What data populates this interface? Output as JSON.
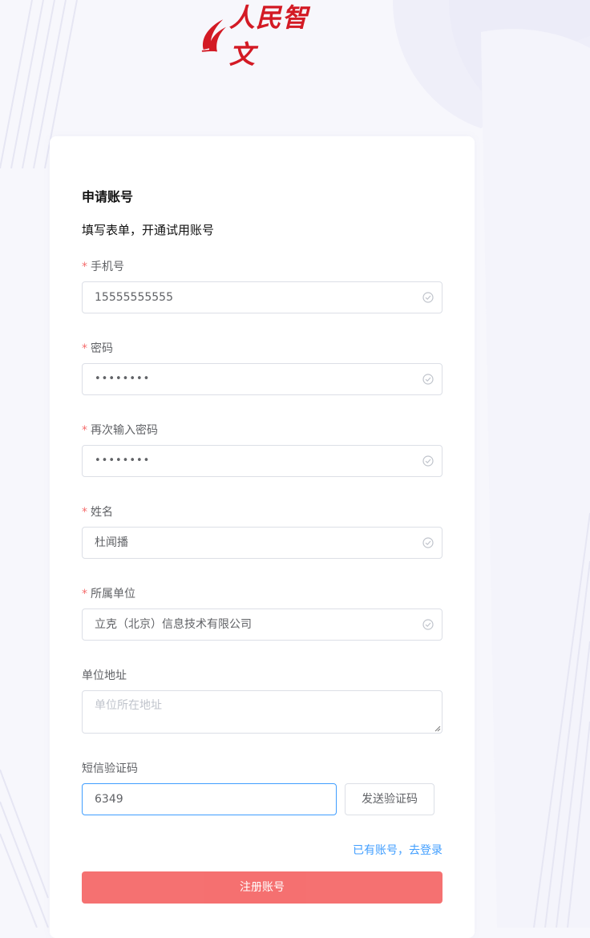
{
  "brand": {
    "logo_text": "人民智文",
    "accent": "#d31a24"
  },
  "form": {
    "title": "申请账号",
    "subtitle": "填写表单，开通试用账号",
    "fields": [
      {
        "label": "手机号",
        "value": "15555555555",
        "required": true,
        "type": "text"
      },
      {
        "label": "密码",
        "value": "••••••••",
        "required": true,
        "type": "password"
      },
      {
        "label": "再次输入密码",
        "value": "••••••••",
        "required": true,
        "type": "password"
      },
      {
        "label": "姓名",
        "value": "杜闻播",
        "required": true,
        "type": "text"
      },
      {
        "label": "所属单位",
        "value": "立克（北京）信息技术有限公司",
        "required": true,
        "type": "text"
      }
    ],
    "address": {
      "label": "单位地址",
      "placeholder": "单位所在地址",
      "value": ""
    },
    "sms": {
      "label": "短信验证码",
      "value": "6349",
      "send_label": "发送验证码"
    },
    "login_link": "已有账号，去登录",
    "submit_label": "注册账号",
    "required_mark": "*"
  },
  "colors": {
    "required": "#f56c6c",
    "link": "#409eff",
    "submit": "#f56c6c",
    "border": "#dcdfe6",
    "focus_border": "#409eff"
  },
  "icons": {
    "field_status": "check-circle-icon",
    "logo_mark": "flame-ribbon-icon"
  }
}
